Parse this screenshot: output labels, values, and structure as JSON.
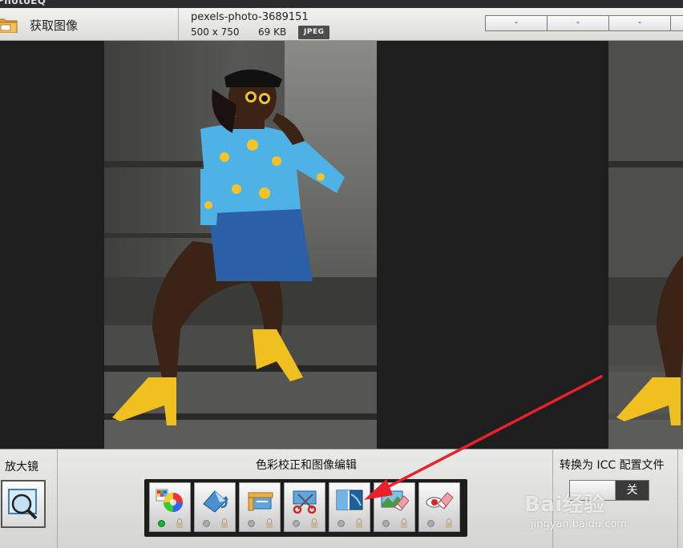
{
  "app": {
    "title": "PhotoEQ"
  },
  "header": {
    "acquire_label": "获取图像",
    "file_name": "pexels-photo-3689151",
    "dimensions": "500 x 750",
    "file_size": "69 KB",
    "format_badge": "JPEG",
    "buttons": [
      "-",
      "-",
      "-"
    ]
  },
  "bottom": {
    "magnifier_label": "放大镜",
    "center_title": "色彩校正和图像编辑",
    "tools": [
      {
        "icon": "color-wheel-icon",
        "status": "on"
      },
      {
        "icon": "rotate-image-icon",
        "status": "off"
      },
      {
        "icon": "crop-ruler-icon",
        "status": "off"
      },
      {
        "icon": "scissors-cut-icon",
        "status": "off"
      },
      {
        "icon": "split-compare-icon",
        "status": "off"
      },
      {
        "icon": "eraser-image-icon",
        "status": "off"
      },
      {
        "icon": "red-eye-eraser-icon",
        "status": "off"
      }
    ],
    "icc_label": "转换为 ICC 配置文件",
    "icc_toggle_value": "关"
  },
  "watermark": {
    "logo": "Bai经验",
    "url": "jingyan.baidu.com"
  },
  "colors": {
    "active_dot": "#19b030",
    "annotation_arrow": "#e8212b",
    "toolbar_bg": "#1d1d1d"
  }
}
